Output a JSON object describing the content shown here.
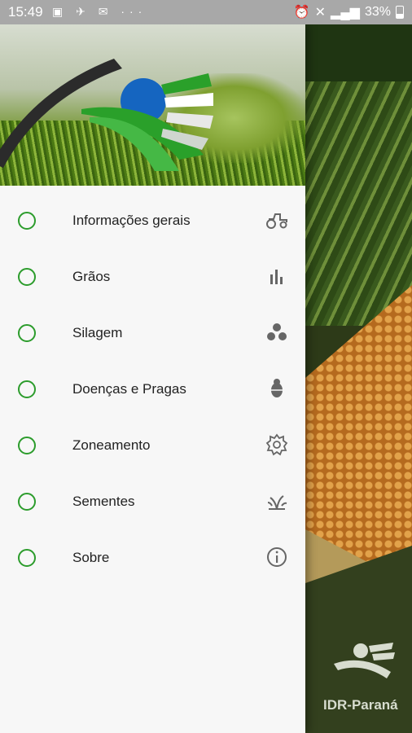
{
  "status_bar": {
    "time": "15:49",
    "battery": "33%"
  },
  "brand": {
    "logo_text": "IDR-Paraná",
    "accent_green": "#2c9c2c"
  },
  "menu": {
    "items": [
      {
        "label": "Informações gerais",
        "icon": "tractor-icon"
      },
      {
        "label": "Grãos",
        "icon": "bar-chart-icon"
      },
      {
        "label": "Silagem",
        "icon": "grain-dots-icon"
      },
      {
        "label": "Doenças e Pragas",
        "icon": "bug-icon"
      },
      {
        "label": "Zoneamento",
        "icon": "gear-icon"
      },
      {
        "label": "Sementes",
        "icon": "sprout-icon"
      },
      {
        "label": "Sobre",
        "icon": "info-icon"
      }
    ]
  }
}
